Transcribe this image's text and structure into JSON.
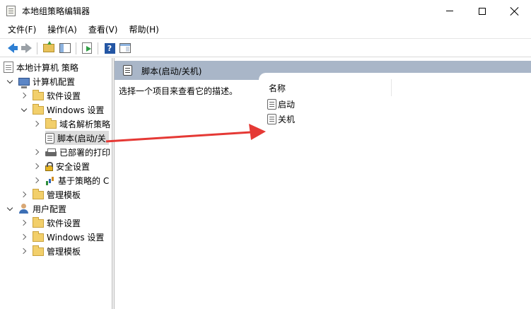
{
  "window": {
    "title": "本地组策略编辑器"
  },
  "menu": [
    {
      "label": "文件(F)"
    },
    {
      "label": "操作(A)"
    },
    {
      "label": "查看(V)"
    },
    {
      "label": "帮助(H)"
    }
  ],
  "toolbar": {
    "icons": [
      "back-arrow-icon",
      "forward-arrow-icon",
      "up-folder-icon",
      "show-tree-icon",
      "export-icon",
      "help-icon",
      "properties-panel-icon"
    ]
  },
  "tree": {
    "root": "本地计算机 策略",
    "computer_config": "计算机配置",
    "computer_software": "软件设置",
    "computer_windows": "Windows 设置",
    "dns_policy": "域名解析策略",
    "scripts": "脚本(启动/关",
    "printers": "已部署的打印",
    "security": "安全设置",
    "qos": "基于策略的 C",
    "computer_admin": "管理模板",
    "user_config": "用户配置",
    "user_software": "软件设置",
    "user_windows": "Windows 设置",
    "user_admin": "管理模板"
  },
  "right": {
    "header_title": "脚本(启动/关机)",
    "description": "选择一个项目来查看它的描述。",
    "column_name": "名称",
    "items": [
      {
        "label": "启动"
      },
      {
        "label": "关机"
      }
    ]
  },
  "colors": {
    "header_bg": "#a9b6c8",
    "arrow": "#e53935"
  }
}
